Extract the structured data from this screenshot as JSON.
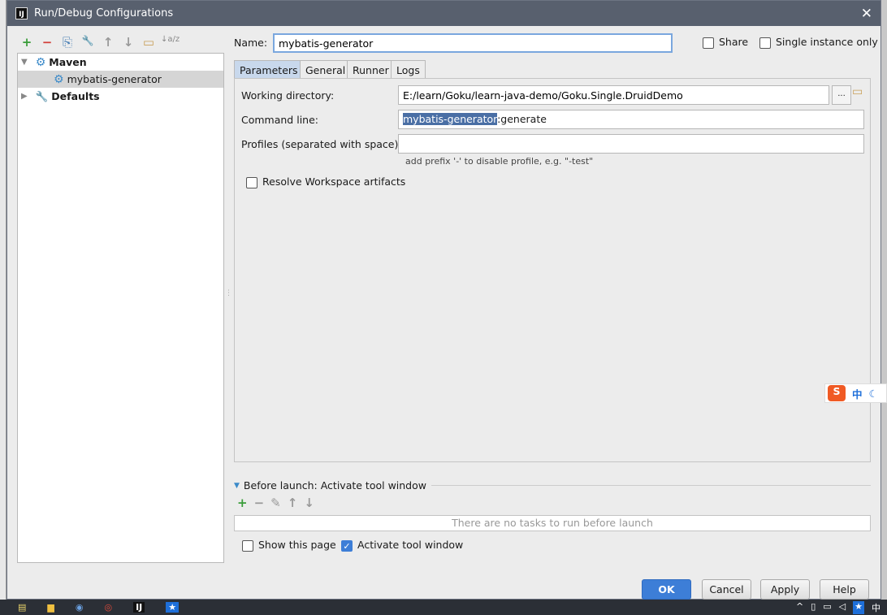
{
  "dialog": {
    "title": "Run/Debug Configurations",
    "app_icon": "IJ"
  },
  "toolbar": {
    "add": "+",
    "remove": "−",
    "copy": "⎘",
    "edit_defaults": "🔧",
    "up": "↑",
    "down": "↓",
    "folder": "▭",
    "sort": "↓a/z"
  },
  "tree": {
    "maven": "Maven",
    "config": "mybatis-generator",
    "defaults": "Defaults"
  },
  "name": {
    "label": "Name:",
    "value": "mybatis-generator"
  },
  "share": {
    "label": "Share",
    "checked": false
  },
  "single_instance": {
    "label": "Single instance only",
    "checked": false
  },
  "tabs": [
    "Parameters",
    "General",
    "Runner",
    "Logs"
  ],
  "params": {
    "working_dir_label": "Working directory:",
    "working_dir": "E:/learn/Goku/learn-java-demo/Goku.Single.DruidDemo",
    "browse": "...",
    "command_label": "Command line:",
    "command_selected": "mybatis-generator",
    "command_rest": ":generate",
    "profiles_label": "Profiles (separated with space):",
    "profiles_value": "",
    "profiles_hint": "add prefix '-' to disable profile, e.g. \"-test\"",
    "resolve_label": "Resolve Workspace artifacts"
  },
  "before_launch": {
    "title": "Before launch: Activate tool window",
    "empty": "There are no tasks to run before launch"
  },
  "show_page": {
    "label": "Show this page",
    "checked": false
  },
  "activate_tool": {
    "label": "Activate tool window",
    "checked": true
  },
  "buttons": {
    "ok": "OK",
    "cancel": "Cancel",
    "apply": "Apply",
    "help": "Help"
  },
  "ime": {
    "logo": "S",
    "lang": "中",
    "moon": "☾"
  },
  "taskbar": {
    "ij": "IJ",
    "tray_lang": "中"
  },
  "colors": {
    "accent": "#3d7ed7",
    "titlebar": "#58606e",
    "selection": "#4a6fa5"
  }
}
